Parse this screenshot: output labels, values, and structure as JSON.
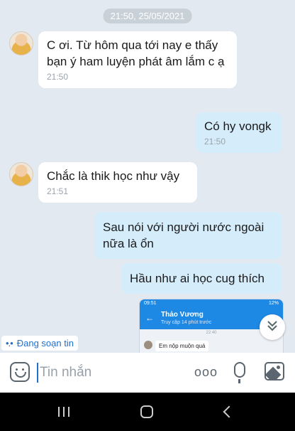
{
  "chat": {
    "date_separator": "21:50, 25/05/2021",
    "messages": [
      {
        "side": "in",
        "text": "C ơi. Từ hôm qua tới nay e thấy bạn ý ham luyện phát âm lắm c ạ",
        "time": "21:50"
      },
      {
        "side": "out",
        "text": "Có hy vongk",
        "time": "21:50"
      },
      {
        "side": "in",
        "text": "Chắc là thik học như vậy",
        "time": "21:51"
      },
      {
        "side": "out",
        "text": "Sau nói với người nước ngoài nữa là ổn",
        "time": ""
      },
      {
        "side": "out",
        "text": "Hầu như ai học cug thích",
        "time": ""
      }
    ],
    "typing_indicator": "Đang soạn tin",
    "shared_screenshot": {
      "status_time": "09:51",
      "status_right": "12%",
      "contact_name": "Thảo Vương",
      "contact_status": "Truy cập 14 phút trước",
      "mini_time": "22:40",
      "mini_message": "Em nộp muộn quá"
    }
  },
  "composer": {
    "placeholder": "Tin nhắn",
    "more_label": "ooo"
  },
  "icons": {
    "sticker": "sticker-icon",
    "more": "more-icon",
    "mic": "microphone-icon",
    "image": "image-icon",
    "scroll_down": "chevron-double-down-icon"
  },
  "colors": {
    "chat_bg": "#e2e9f1",
    "incoming_bubble": "#ffffff",
    "outgoing_bubble": "#d5ecfb",
    "accent": "#1f6fcf"
  }
}
